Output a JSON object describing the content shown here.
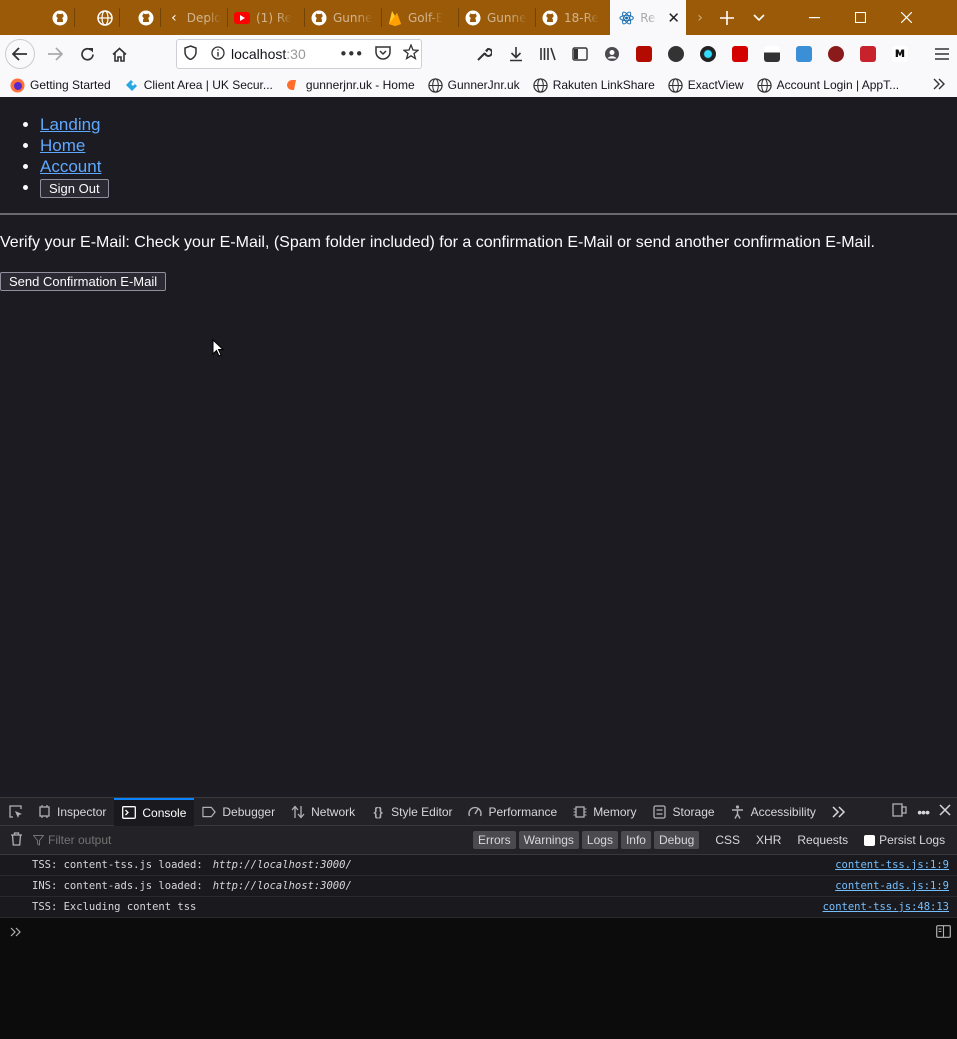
{
  "browser": {
    "tabs": [
      {
        "label": "Deplo",
        "icon": "chevron-left-icon"
      },
      {
        "label": "(1) Re",
        "icon": "youtube-icon"
      },
      {
        "label": "Gunne",
        "icon": "github-icon"
      },
      {
        "label": "Golf-E",
        "icon": "firebase-icon"
      },
      {
        "label": "Gunne",
        "icon": "github-icon"
      },
      {
        "label": "18-Re",
        "icon": "github-icon"
      },
      {
        "label": "Re",
        "icon": "react-icon",
        "active": true
      }
    ],
    "url": "localhost",
    "url_dim": ":30",
    "bookmarks": [
      {
        "label": "Getting Started",
        "icon": "firefox-icon"
      },
      {
        "label": "Client Area | UK Secur...",
        "icon": "bookmark-favicon-icon"
      },
      {
        "label": "gunnerjnr.uk - Home",
        "icon": "cpanel-icon"
      },
      {
        "label": "GunnerJnr.uk",
        "icon": "globe-icon"
      },
      {
        "label": "Rakuten LinkShare",
        "icon": "globe-icon"
      },
      {
        "label": "ExactView",
        "icon": "globe-icon"
      },
      {
        "label": "Account Login | AppT...",
        "icon": "globe-icon"
      }
    ]
  },
  "page": {
    "nav": {
      "landing": "Landing",
      "home": "Home",
      "account": "Account",
      "sign_out": "Sign Out"
    },
    "verify_text": "Verify your E-Mail: Check your E-Mail, (Spam folder included) for a confirmation E-Mail or send another confirmation E-Mail.",
    "send_button": "Send Confirmation E-Mail"
  },
  "devtools": {
    "tabs": [
      "Inspector",
      "Console",
      "Debugger",
      "Network",
      "Style Editor",
      "Performance",
      "Memory",
      "Storage",
      "Accessibility"
    ],
    "active_tab": "Console",
    "filter_placeholder": "Filter output",
    "levels": [
      "Errors",
      "Warnings",
      "Logs",
      "Info",
      "Debug"
    ],
    "request_filters": [
      "CSS",
      "XHR",
      "Requests"
    ],
    "persist_logs": "Persist Logs",
    "logs": [
      {
        "text": "TSS: content-tss.js loaded:",
        "url": "http://localhost:3000/",
        "source": "content-tss.js:1:9"
      },
      {
        "text": "INS: content-ads.js loaded:",
        "url": "http://localhost:3000/",
        "source": "content-ads.js:1:9"
      },
      {
        "text": "TSS: Excluding content tss",
        "url": "",
        "source": "content-tss.js:48:13"
      }
    ]
  }
}
